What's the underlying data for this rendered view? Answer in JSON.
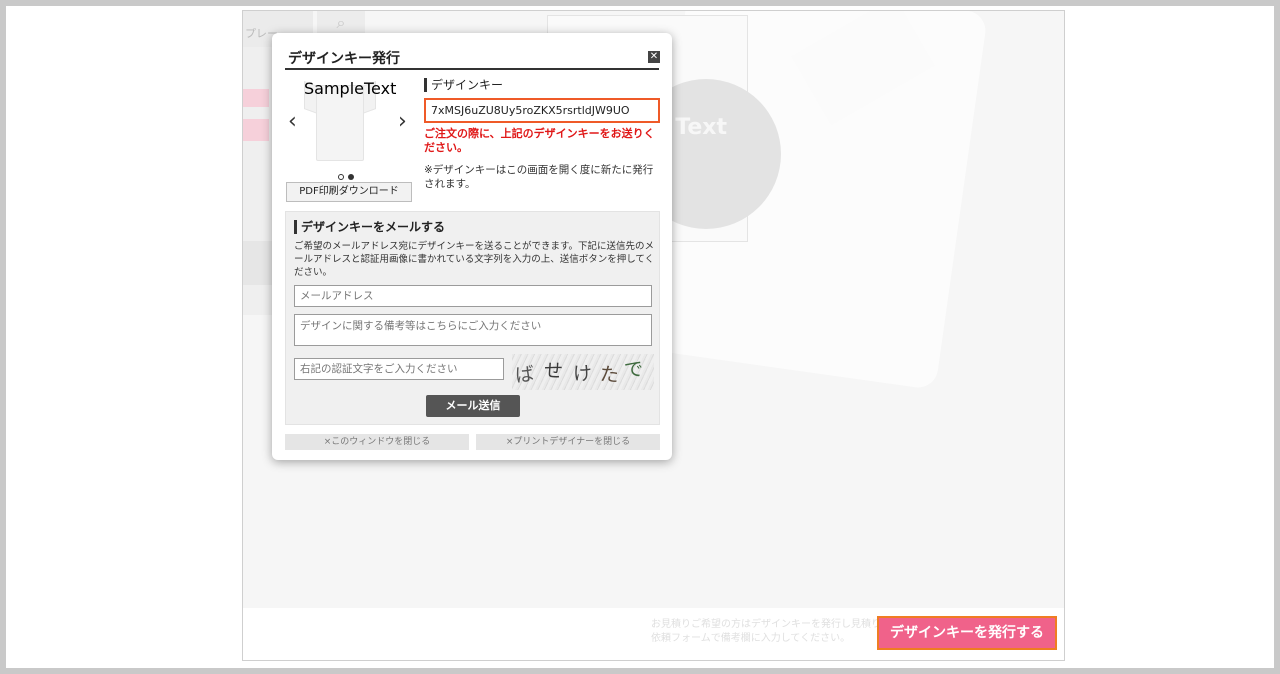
{
  "background": {
    "tab_label": "プレー",
    "preview_text": "Text",
    "footer_note": "お見積りご希望の方はデザインキーを発行し見積り依頼フォームで備考欄に入力してください。",
    "issue_button_label": "デザインキーを発行する"
  },
  "modal": {
    "title": "デザインキー発行",
    "close_icon": "close-icon",
    "thumbnail_print_text": "SampleText",
    "prev_icon": "chevron-left-icon",
    "next_icon": "chevron-right-icon",
    "pdf_button_label": "PDF印刷ダウンロード",
    "key_label": "デザインキー",
    "key_value": "7xMSJ6uZU8Uy5roZKX5rsrtldJW9UO",
    "key_warning": "ご注文の際に、上記のデザインキーをお送りください。",
    "key_note": "※デザインキーはこの画面を開く度に新たに発行されます。",
    "mail": {
      "heading": "デザインキーをメールする",
      "description": "ご希望のメールアドレス宛にデザインキーを送ることができます。下記に送信先のメールアドレスと認証用画像に書かれている文字列を入力の上、送信ボタンを押してください。",
      "email_placeholder": "メールアドレス",
      "note_placeholder": "デザインに関する備考等はこちらにご入力ください",
      "captcha_placeholder": "右記の認証文字をご入力ください",
      "captcha_chars": [
        "ば",
        "せ",
        "け",
        "た",
        "で"
      ],
      "send_label": "メール送信"
    },
    "close_window_label": "×このウィンドウを閉じる",
    "close_designer_label": "×プリントデザイナーを閉じる"
  },
  "colors": {
    "accent_pink": "#f0628a",
    "highlight_orange": "#ef5a28",
    "warning_red": "#e01818"
  }
}
